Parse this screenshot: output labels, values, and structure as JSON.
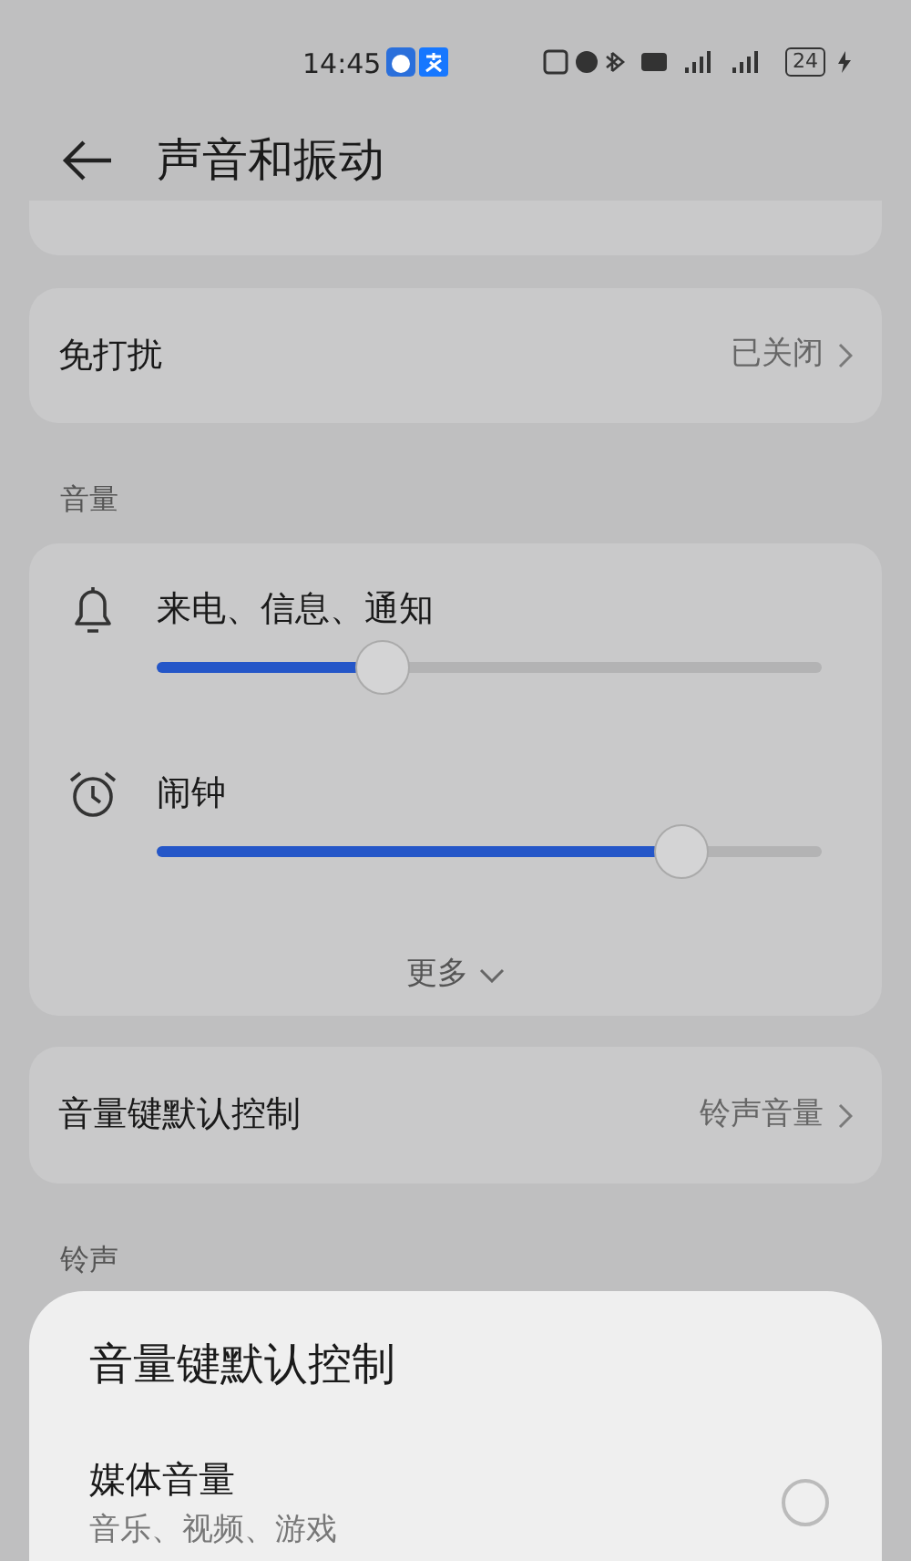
{
  "status_bar": {
    "time": "14:45",
    "battery": "24"
  },
  "header": {
    "title": "声音和振动"
  },
  "do_not_disturb": {
    "label": "免打扰",
    "value": "已关闭"
  },
  "volume_section": {
    "title": "音量",
    "sliders": [
      {
        "label": "来电、信息、通知",
        "level": 0.34
      },
      {
        "label": "闹钟",
        "level": 0.79
      }
    ],
    "more": "更多"
  },
  "volume_key": {
    "label": "音量键默认控制",
    "value": "铃声音量"
  },
  "ringtone_section": {
    "title": "铃声"
  },
  "sheet": {
    "title": "音量键默认控制",
    "options": [
      {
        "label": "媒体音量",
        "description": "音乐、视频、游戏",
        "selected": false
      }
    ]
  }
}
